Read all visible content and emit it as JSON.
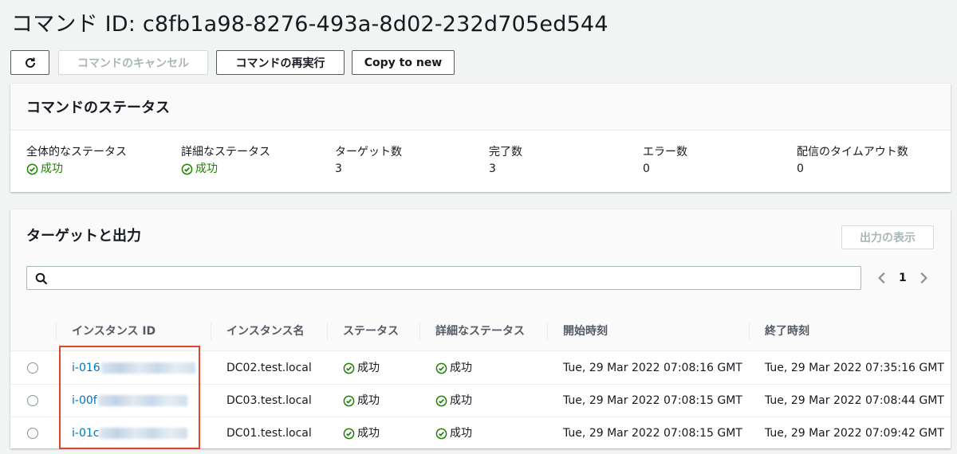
{
  "page_title": "コマンド ID: c8fb1a98-8276-493a-8d02-232d705ed544",
  "toolbar": {
    "refresh_icon": "refresh-icon",
    "cancel_label": "コマンドのキャンセル",
    "rerun_label": "コマンドの再実行",
    "copy_label": "Copy to new"
  },
  "status_panel": {
    "title": "コマンドのステータス",
    "stats": [
      {
        "label": "全体的なステータス",
        "value": "成功",
        "success": true
      },
      {
        "label": "詳細なステータス",
        "value": "成功",
        "success": true
      },
      {
        "label": "ターゲット数",
        "value": "3"
      },
      {
        "label": "完了数",
        "value": "3"
      },
      {
        "label": "エラー数",
        "value": "0"
      },
      {
        "label": "配信のタイムアウト数",
        "value": "0"
      }
    ]
  },
  "targets_panel": {
    "title": "ターゲットと出力",
    "show_output_label": "出力の表示",
    "search_placeholder": "",
    "page": "1",
    "columns": [
      "インスタンス ID",
      "インスタンス名",
      "ステータス",
      "詳細なステータス",
      "開始時刻",
      "終了時刻"
    ],
    "rows": [
      {
        "instance_id": "i-016",
        "instance_name": "DC02.test.local",
        "status": "成功",
        "detail_status": "成功",
        "start": "Tue, 29 Mar 2022 07:08:16 GMT",
        "end": "Tue, 29 Mar 2022 07:35:16 GMT"
      },
      {
        "instance_id": "i-00f",
        "instance_name": "DC03.test.local",
        "status": "成功",
        "detail_status": "成功",
        "start": "Tue, 29 Mar 2022 07:08:15 GMT",
        "end": "Tue, 29 Mar 2022 07:08:44 GMT"
      },
      {
        "instance_id": "i-01c",
        "instance_name": "DC01.test.local",
        "status": "成功",
        "detail_status": "成功",
        "start": "Tue, 29 Mar 2022 07:08:15 GMT",
        "end": "Tue, 29 Mar 2022 07:09:42 GMT"
      }
    ]
  },
  "colors": {
    "success": "#1d8102",
    "link": "#0073bb",
    "highlight_border": "#e0452a"
  }
}
